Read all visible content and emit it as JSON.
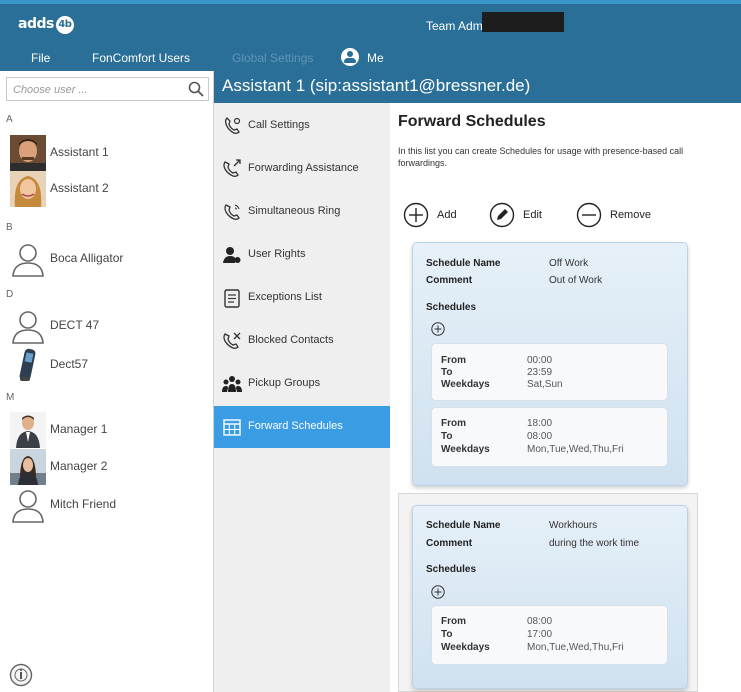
{
  "app": {
    "logo_text": "adds",
    "logo_badge": "4b",
    "title": "Team Admin Dashboard"
  },
  "menu": {
    "file": "File",
    "fon_users": "FonComfort Users",
    "global_settings": "Global Settings",
    "me": "Me"
  },
  "search": {
    "placeholder": "Choose user ..."
  },
  "users": {
    "groups": [
      {
        "letter": "A",
        "items": [
          {
            "name": "Assistant 1",
            "avatar": "photo-man"
          },
          {
            "name": "Assistant 2",
            "avatar": "photo-woman"
          }
        ]
      },
      {
        "letter": "B",
        "items": [
          {
            "name": "Boca Alligator",
            "avatar": "person-outline-icon"
          }
        ]
      },
      {
        "letter": "D",
        "items": [
          {
            "name": "DECT 47",
            "avatar": "person-outline-icon"
          },
          {
            "name": "Dect57",
            "avatar": "dect-phone-icon"
          }
        ]
      },
      {
        "letter": "M",
        "items": [
          {
            "name": "Manager 1",
            "avatar": "photo-man-suit"
          },
          {
            "name": "Manager 2",
            "avatar": "photo-woman-office"
          },
          {
            "name": "Mitch Friend",
            "avatar": "person-outline-icon"
          }
        ]
      }
    ]
  },
  "header": {
    "title": "Assistant 1 (sip:assistant1@bressner.de)"
  },
  "nav": {
    "items": [
      {
        "label": "Call Settings",
        "icon": "phone-settings-icon"
      },
      {
        "label": "Forwarding Assistance",
        "icon": "forward-call-icon"
      },
      {
        "label": "Simultaneous Ring",
        "icon": "ring-icon"
      },
      {
        "label": "User Rights",
        "icon": "user-rights-icon"
      },
      {
        "label": "Exceptions List",
        "icon": "list-icon"
      },
      {
        "label": "Blocked Contacts",
        "icon": "blocked-call-icon"
      },
      {
        "label": "Pickup Groups",
        "icon": "group-icon"
      },
      {
        "label": "Forward Schedules",
        "icon": "calendar-icon",
        "active": true
      }
    ]
  },
  "page": {
    "title": "Forward Schedules",
    "description": "In this list you can create Schedules for usage with presence-based call forwardings.",
    "actions": {
      "add": "Add",
      "edit": "Edit",
      "remove": "Remove"
    }
  },
  "labels": {
    "schedule_name": "Schedule Name",
    "comment": "Comment",
    "schedules": "Schedules",
    "from": "From",
    "to": "To",
    "weekdays": "Weekdays"
  },
  "schedules": [
    {
      "name": "Off Work",
      "comment": "Out of Work",
      "entries": [
        {
          "from": "00:00",
          "to": "23:59",
          "weekdays": "Sat,Sun"
        },
        {
          "from": "18:00",
          "to": "08:00",
          "weekdays": "Mon,Tue,Wed,Thu,Fri"
        }
      ]
    },
    {
      "name": "Workhours",
      "comment": "during the work time",
      "entries": [
        {
          "from": "08:00",
          "to": "17:00",
          "weekdays": "Mon,Tue,Wed,Thu,Fri"
        }
      ]
    }
  ],
  "colors": {
    "titlebar": "#2a6f98",
    "accent": "#3a9de4",
    "sidebar": "#efefef"
  }
}
